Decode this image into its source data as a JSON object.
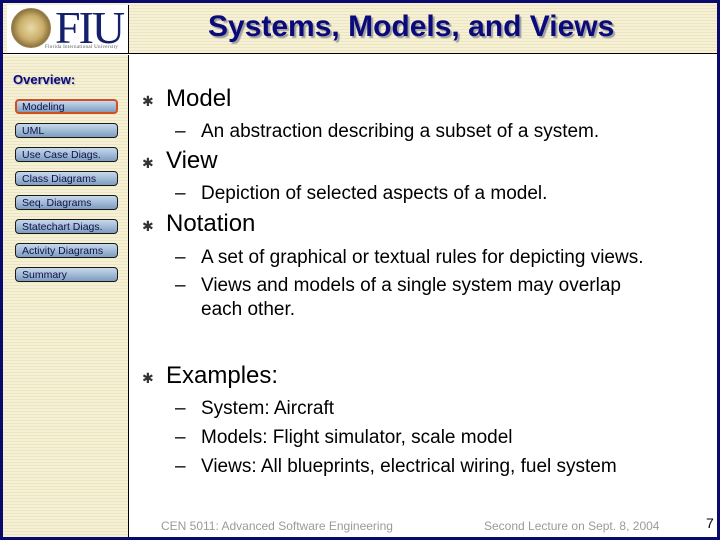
{
  "header": {
    "logo_text": "FIU",
    "logo_subtitle": "Florida International University",
    "title": "Systems, Models, and Views"
  },
  "sidebar": {
    "heading": "Overview:",
    "items": [
      {
        "label": "Modeling",
        "active": true
      },
      {
        "label": "UML",
        "active": false
      },
      {
        "label": "Use Case Diags.",
        "active": false
      },
      {
        "label": "Class Diagrams",
        "active": false
      },
      {
        "label": "Seq. Diagrams",
        "active": false
      },
      {
        "label": "Statechart Diags.",
        "active": false
      },
      {
        "label": "Activity Diagrams",
        "active": false
      },
      {
        "label": "Summary",
        "active": false
      }
    ]
  },
  "content": {
    "bullets": [
      {
        "text": "Model",
        "subs": [
          "An abstraction describing a subset of a system."
        ]
      },
      {
        "text": "View",
        "subs": [
          "Depiction of selected aspects of a model."
        ]
      },
      {
        "text": "Notation",
        "subs": [
          "A set of graphical or textual rules for depicting views.",
          "Views and models of a single system may overlap",
          "each other."
        ]
      },
      {
        "text": "Examples:",
        "subs": [
          "System: Aircraft",
          "Models: Flight simulator, scale model",
          "Views: All blueprints, electrical wiring, fuel system"
        ]
      }
    ]
  },
  "footer": {
    "course": "CEN 5011: Advanced Software Engineering",
    "lecture": "Second Lecture on Sept. 8, 2004",
    "page_number": "7"
  },
  "colors": {
    "title": "#0a0a7a",
    "active_border": "#d2501f",
    "button": "#9fb8d4",
    "frame": "#0a0a6e"
  }
}
